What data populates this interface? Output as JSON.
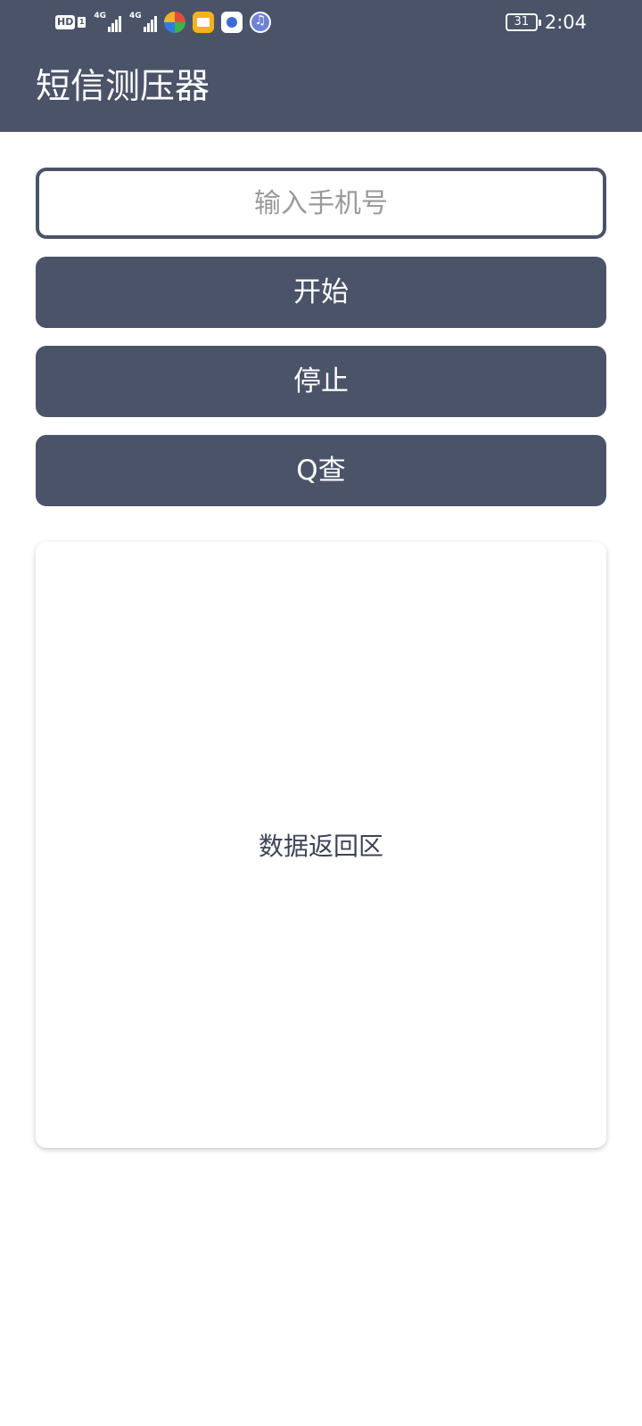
{
  "status_bar": {
    "hd_label": "HD",
    "sim_label": "1",
    "signal_1_tag": "4G",
    "signal_2_tag": "4G",
    "battery_level": "31",
    "time": "2:04",
    "app_icons": [
      "colorful-circle-app-icon",
      "mail-app-icon",
      "baidu-app-icon",
      "music-app-icon"
    ]
  },
  "app_bar": {
    "title": "短信测压器"
  },
  "form": {
    "phone_placeholder": "输入手机号",
    "phone_value": "",
    "start_label": "开始",
    "stop_label": "停止",
    "query_label": "Q查"
  },
  "result": {
    "placeholder_text": "数据返回区"
  },
  "colors": {
    "primary": "#4b5369",
    "background": "#ffffff"
  }
}
